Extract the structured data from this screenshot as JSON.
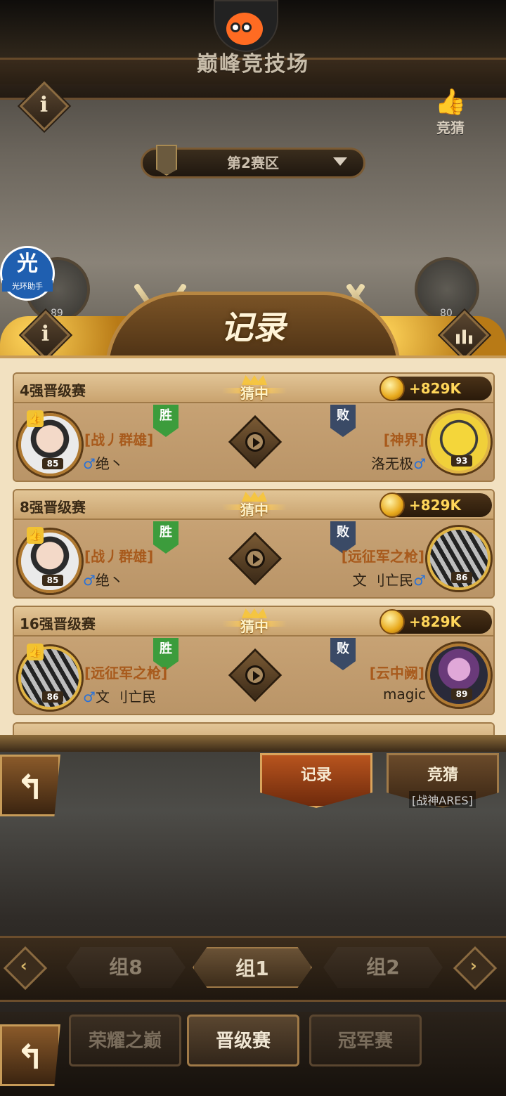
{
  "header": {
    "title": "巅峰竞技场",
    "guess_label": "竞猜"
  },
  "region": {
    "selected": "第2赛区"
  },
  "helper_badge": {
    "main": "光",
    "sub": "光环助手"
  },
  "background_levels": {
    "left": "89",
    "right": "80"
  },
  "banner": {
    "title": "记录"
  },
  "matches": [
    {
      "stage": "4强晋级赛",
      "status": "猜中",
      "reward": "+829K",
      "win_label": "胜",
      "lose_label": "败",
      "left": {
        "guild": "[战丿群雄]",
        "name": "绝丶",
        "level": "85"
      },
      "right": {
        "guild": "[神界]",
        "name": "洛无极",
        "level": "93"
      }
    },
    {
      "stage": "8强晋级赛",
      "status": "猜中",
      "reward": "+829K",
      "win_label": "胜",
      "lose_label": "败",
      "left": {
        "guild": "[战丿群雄]",
        "name": "绝丶",
        "level": "85"
      },
      "right": {
        "guild": "[远征军之枪]",
        "name": "文 刂亡民",
        "level": "86"
      }
    },
    {
      "stage": "16强晋级赛",
      "status": "猜中",
      "reward": "+829K",
      "win_label": "胜",
      "lose_label": "败",
      "left": {
        "guild": "[远征军之枪]",
        "name": "文 刂亡民",
        "level": "86"
      },
      "right": {
        "guild": "[云中阙]",
        "name": "magic",
        "level": "89"
      }
    }
  ],
  "male_symbol": "♂",
  "actions": {
    "record": "记录",
    "guess": "竞猜",
    "champion_tag": "[战神ARES]"
  },
  "groups": {
    "prev": "组8",
    "current": "组1",
    "next": "组2"
  },
  "nav": {
    "glory": "荣耀之巅",
    "promotion": "晋级赛",
    "champion": "冠军赛"
  },
  "colors": {
    "panel": "#f2e1c1",
    "reward_text": "#ffd65a",
    "win_flag": "#3c9c3c",
    "lose_flag": "#3a4a66",
    "guild_text": "#a85a1c"
  }
}
